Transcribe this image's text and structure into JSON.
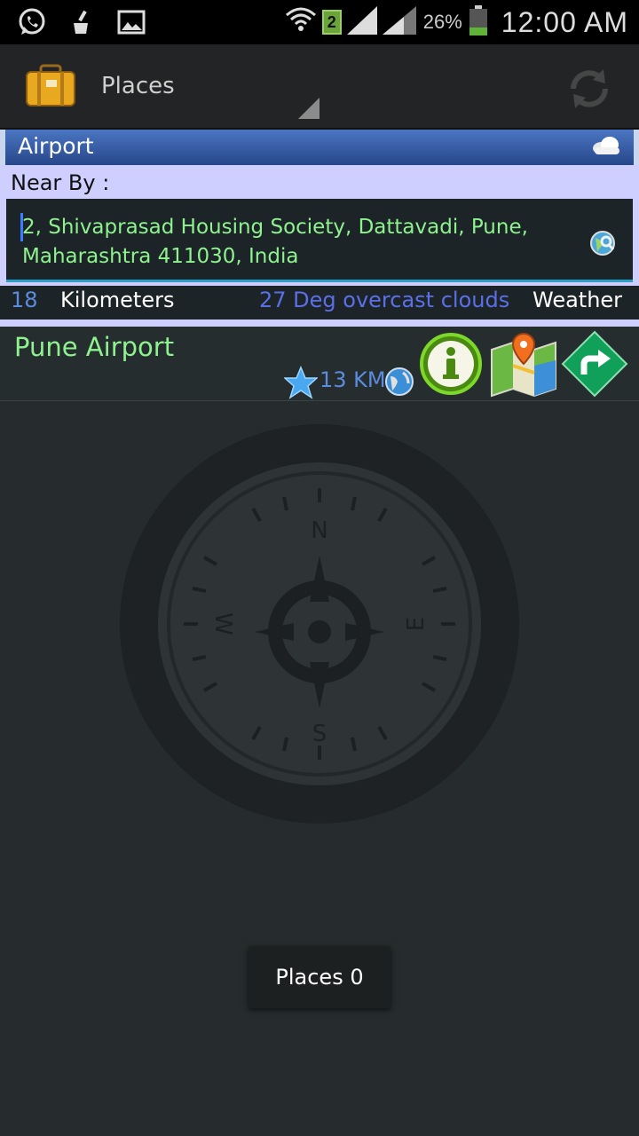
{
  "status_bar": {
    "battery_percent": "26%",
    "time": "12:00 AM",
    "sim_slot": "2",
    "icons": [
      "whatsapp-icon",
      "cleaner-icon",
      "gallery-icon",
      "wifi-icon",
      "signal-icon",
      "battery-icon"
    ]
  },
  "action_bar": {
    "title": "Places",
    "icons": [
      "suitcase-logo-icon",
      "refresh-icon"
    ]
  },
  "category": {
    "label": "Airport",
    "icon": "cloud-icon"
  },
  "near_by": {
    "label": "Near By :",
    "address": "2, Shivaprasad Housing Society, Dattavadi, Pune, Maharashtra 411030, India",
    "radius_value": "18",
    "radius_unit": "Kilometers",
    "weather_text": "27 Deg overcast clouds",
    "weather_button": "Weather"
  },
  "results": [
    {
      "name": "Pune Airport",
      "distance": "13 KM",
      "icons": [
        "star-icon",
        "globe-icon",
        "info-icon",
        "map-icon",
        "directions-icon"
      ]
    }
  ],
  "toast": {
    "text": "Places 0"
  },
  "colors": {
    "accent_green": "#8ef28e",
    "accent_blue": "#5b8ce0",
    "panel_lavender": "#cfcfff",
    "header_blue": "#3a5eaa"
  }
}
